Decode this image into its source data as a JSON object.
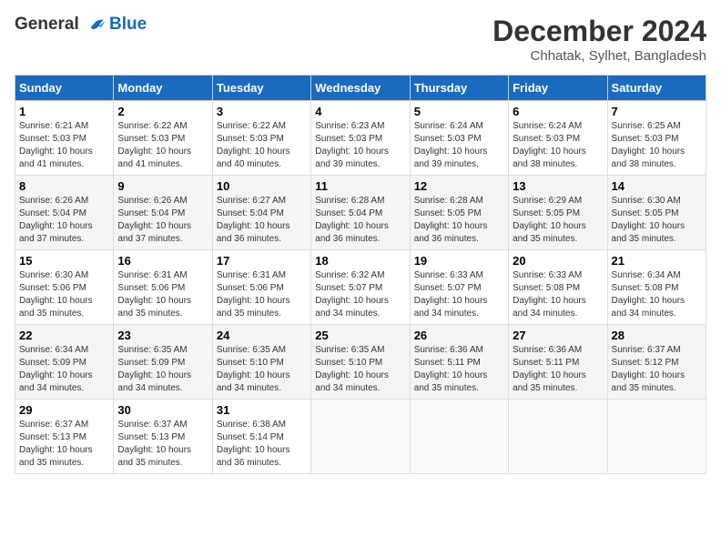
{
  "header": {
    "logo_line1": "General",
    "logo_line2": "Blue",
    "title": "December 2024",
    "subtitle": "Chhatak, Sylhet, Bangladesh"
  },
  "weekdays": [
    "Sunday",
    "Monday",
    "Tuesday",
    "Wednesday",
    "Thursday",
    "Friday",
    "Saturday"
  ],
  "weeks": [
    [
      {
        "day": "1",
        "sunrise": "6:21 AM",
        "sunset": "5:03 PM",
        "daylight": "10 hours and 41 minutes."
      },
      {
        "day": "2",
        "sunrise": "6:22 AM",
        "sunset": "5:03 PM",
        "daylight": "10 hours and 41 minutes."
      },
      {
        "day": "3",
        "sunrise": "6:22 AM",
        "sunset": "5:03 PM",
        "daylight": "10 hours and 40 minutes."
      },
      {
        "day": "4",
        "sunrise": "6:23 AM",
        "sunset": "5:03 PM",
        "daylight": "10 hours and 39 minutes."
      },
      {
        "day": "5",
        "sunrise": "6:24 AM",
        "sunset": "5:03 PM",
        "daylight": "10 hours and 39 minutes."
      },
      {
        "day": "6",
        "sunrise": "6:24 AM",
        "sunset": "5:03 PM",
        "daylight": "10 hours and 38 minutes."
      },
      {
        "day": "7",
        "sunrise": "6:25 AM",
        "sunset": "5:03 PM",
        "daylight": "10 hours and 38 minutes."
      }
    ],
    [
      {
        "day": "8",
        "sunrise": "6:26 AM",
        "sunset": "5:04 PM",
        "daylight": "10 hours and 37 minutes."
      },
      {
        "day": "9",
        "sunrise": "6:26 AM",
        "sunset": "5:04 PM",
        "daylight": "10 hours and 37 minutes."
      },
      {
        "day": "10",
        "sunrise": "6:27 AM",
        "sunset": "5:04 PM",
        "daylight": "10 hours and 36 minutes."
      },
      {
        "day": "11",
        "sunrise": "6:28 AM",
        "sunset": "5:04 PM",
        "daylight": "10 hours and 36 minutes."
      },
      {
        "day": "12",
        "sunrise": "6:28 AM",
        "sunset": "5:05 PM",
        "daylight": "10 hours and 36 minutes."
      },
      {
        "day": "13",
        "sunrise": "6:29 AM",
        "sunset": "5:05 PM",
        "daylight": "10 hours and 35 minutes."
      },
      {
        "day": "14",
        "sunrise": "6:30 AM",
        "sunset": "5:05 PM",
        "daylight": "10 hours and 35 minutes."
      }
    ],
    [
      {
        "day": "15",
        "sunrise": "6:30 AM",
        "sunset": "5:06 PM",
        "daylight": "10 hours and 35 minutes."
      },
      {
        "day": "16",
        "sunrise": "6:31 AM",
        "sunset": "5:06 PM",
        "daylight": "10 hours and 35 minutes."
      },
      {
        "day": "17",
        "sunrise": "6:31 AM",
        "sunset": "5:06 PM",
        "daylight": "10 hours and 35 minutes."
      },
      {
        "day": "18",
        "sunrise": "6:32 AM",
        "sunset": "5:07 PM",
        "daylight": "10 hours and 34 minutes."
      },
      {
        "day": "19",
        "sunrise": "6:33 AM",
        "sunset": "5:07 PM",
        "daylight": "10 hours and 34 minutes."
      },
      {
        "day": "20",
        "sunrise": "6:33 AM",
        "sunset": "5:08 PM",
        "daylight": "10 hours and 34 minutes."
      },
      {
        "day": "21",
        "sunrise": "6:34 AM",
        "sunset": "5:08 PM",
        "daylight": "10 hours and 34 minutes."
      }
    ],
    [
      {
        "day": "22",
        "sunrise": "6:34 AM",
        "sunset": "5:09 PM",
        "daylight": "10 hours and 34 minutes."
      },
      {
        "day": "23",
        "sunrise": "6:35 AM",
        "sunset": "5:09 PM",
        "daylight": "10 hours and 34 minutes."
      },
      {
        "day": "24",
        "sunrise": "6:35 AM",
        "sunset": "5:10 PM",
        "daylight": "10 hours and 34 minutes."
      },
      {
        "day": "25",
        "sunrise": "6:35 AM",
        "sunset": "5:10 PM",
        "daylight": "10 hours and 34 minutes."
      },
      {
        "day": "26",
        "sunrise": "6:36 AM",
        "sunset": "5:11 PM",
        "daylight": "10 hours and 35 minutes."
      },
      {
        "day": "27",
        "sunrise": "6:36 AM",
        "sunset": "5:11 PM",
        "daylight": "10 hours and 35 minutes."
      },
      {
        "day": "28",
        "sunrise": "6:37 AM",
        "sunset": "5:12 PM",
        "daylight": "10 hours and 35 minutes."
      }
    ],
    [
      {
        "day": "29",
        "sunrise": "6:37 AM",
        "sunset": "5:13 PM",
        "daylight": "10 hours and 35 minutes."
      },
      {
        "day": "30",
        "sunrise": "6:37 AM",
        "sunset": "5:13 PM",
        "daylight": "10 hours and 35 minutes."
      },
      {
        "day": "31",
        "sunrise": "6:38 AM",
        "sunset": "5:14 PM",
        "daylight": "10 hours and 36 minutes."
      },
      null,
      null,
      null,
      null
    ]
  ],
  "labels": {
    "sunrise_prefix": "Sunrise: ",
    "sunset_prefix": "Sunset: ",
    "daylight_prefix": "Daylight: "
  }
}
